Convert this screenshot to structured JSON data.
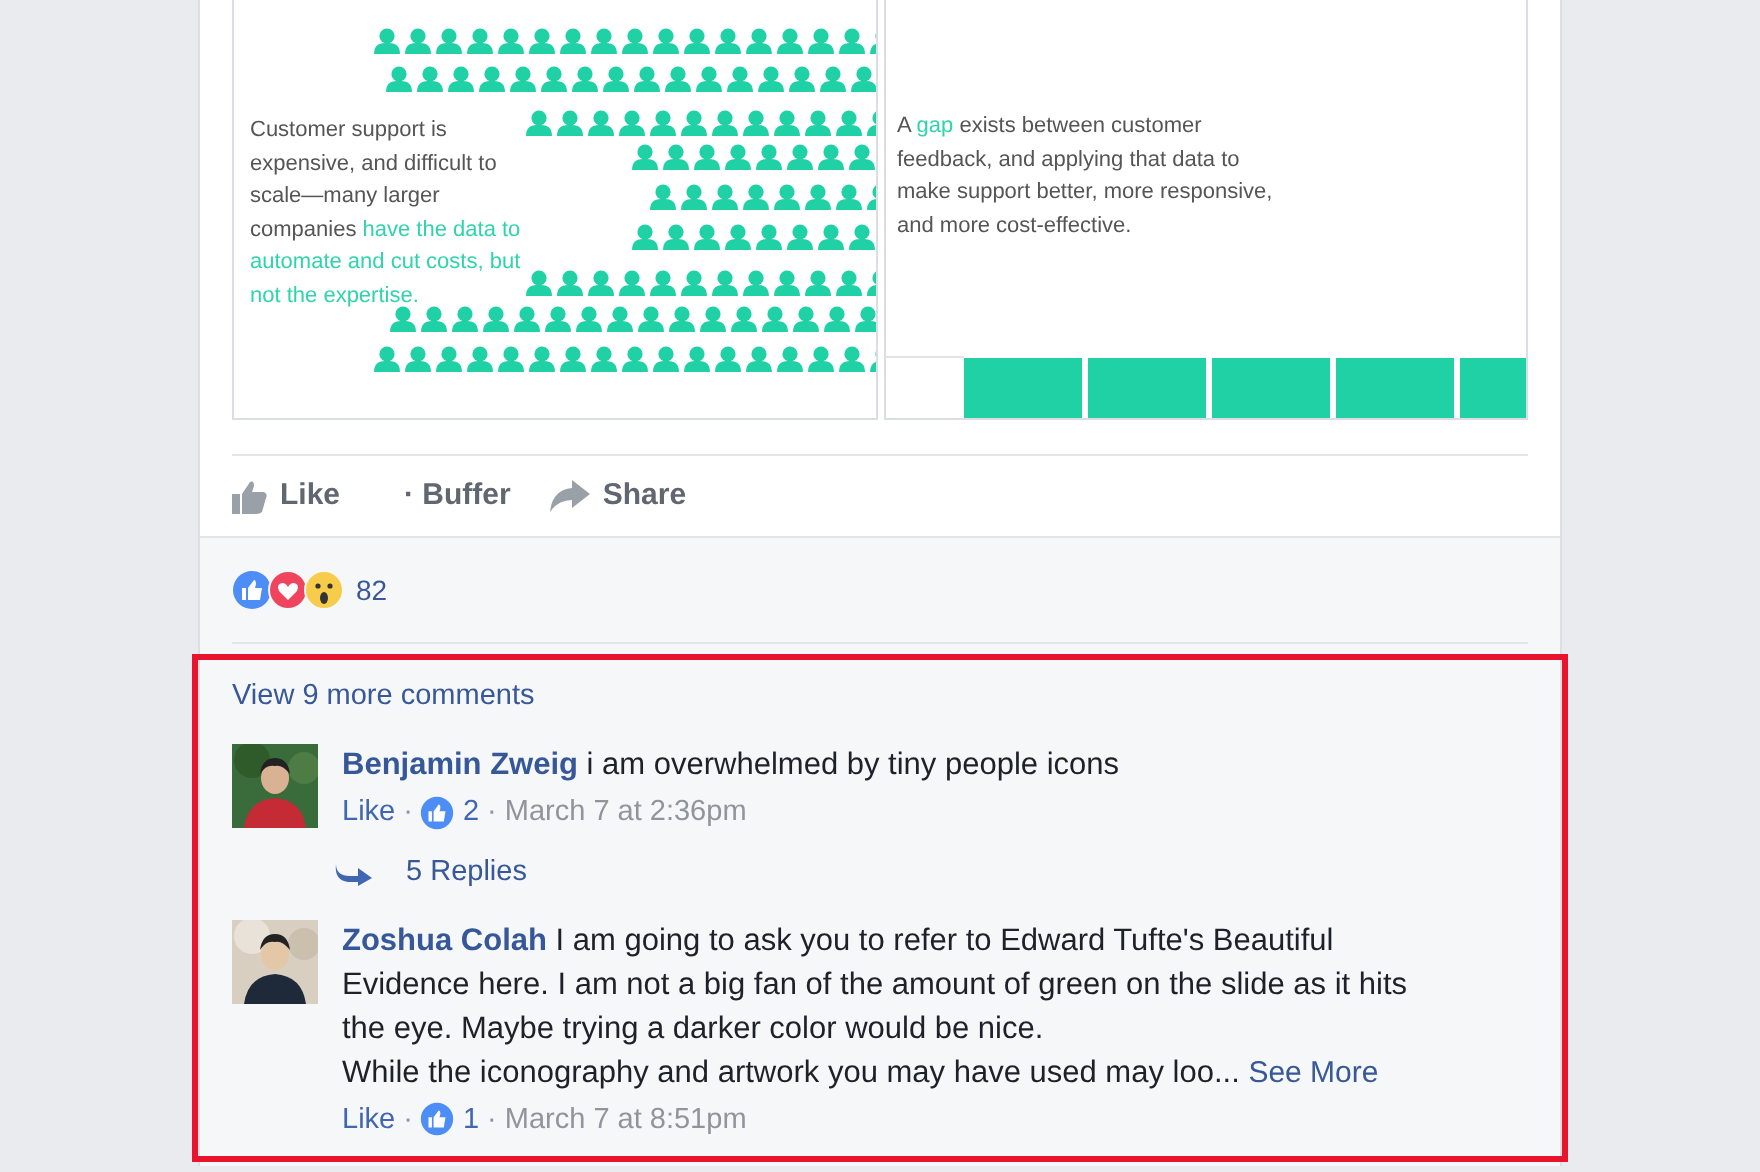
{
  "slides": [
    {
      "kind": "people",
      "segments": [
        {
          "text": "Customer support is expensive, and difficult to scale—many larger companies ",
          "highlight": false
        },
        {
          "text": "have the data to automate and cut costs, but not the expertise.",
          "highlight": true
        }
      ]
    },
    {
      "kind": "bars",
      "segments": [
        {
          "text": "A ",
          "highlight": false
        },
        {
          "text": "gap",
          "highlight": true
        },
        {
          "text": " exists between customer feedback, and applying that data to make support better, more responsive, and more cost-effective.",
          "highlight": false
        }
      ]
    }
  ],
  "actions": [
    {
      "kind": "like",
      "label": "Like"
    },
    {
      "kind": "buffer",
      "label": "· Buffer"
    },
    {
      "kind": "share",
      "label": "Share"
    }
  ],
  "reactions": {
    "count": "82"
  },
  "view_more": "View 9 more comments",
  "comments": [
    {
      "author": "Benjamin Zweig",
      "text": "i am overwhelmed by tiny people icons",
      "meta": [
        {
          "kind": "link",
          "text": "Like"
        },
        {
          "kind": "sep",
          "text": "·"
        },
        {
          "kind": "likes",
          "text": "2"
        },
        {
          "kind": "sep",
          "text": "·"
        },
        {
          "kind": "time",
          "text": "March 7 at 2:36pm"
        }
      ],
      "replies": "5 Replies"
    },
    {
      "author": "Zoshua Colah",
      "text": "I am going to ask you to refer to Edward Tufte's Beautiful Evidence here. I am not a big fan of the amount of green on the slide as it hits the eye. Maybe trying a darker color would be nice.\nWhile the iconography and artwork you may have used may loo...",
      "see_more": "See More",
      "meta": [
        {
          "kind": "link",
          "text": "Like"
        },
        {
          "kind": "sep",
          "text": "·"
        },
        {
          "kind": "likes",
          "text": "1"
        },
        {
          "kind": "sep",
          "text": "·"
        },
        {
          "kind": "time",
          "text": "March 7 at 8:51pm"
        }
      ]
    }
  ]
}
